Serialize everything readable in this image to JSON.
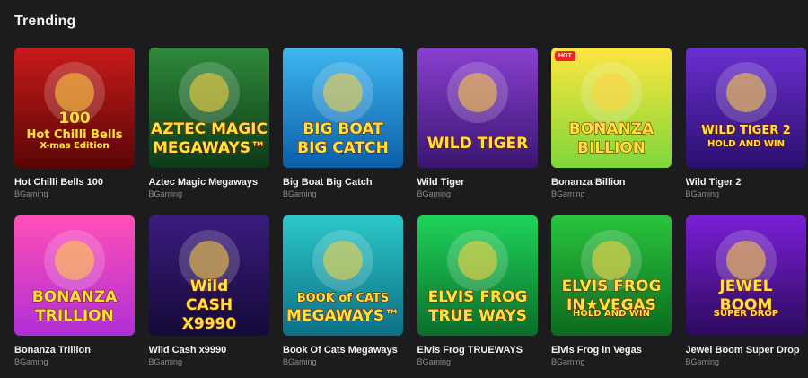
{
  "section": {
    "title": "Trending"
  },
  "games": [
    {
      "title": "Hot Chilli Bells 100",
      "provider": "BGaming",
      "art": [
        "100",
        "Hot Chilli Bells",
        "X-mas Edition"
      ],
      "badge": "",
      "bg": [
        "#c81a1a",
        "#5a0505"
      ],
      "icon": "chilli-bell-icon"
    },
    {
      "title": "Aztec Magic Megaways",
      "provider": "BGaming",
      "art": [
        "AZTEC MAGIC",
        "MEGAWAYS™"
      ],
      "badge": "",
      "bg": [
        "#2e8a3a",
        "#0d3a18"
      ],
      "icon": "aztec-queen-icon"
    },
    {
      "title": "Big Boat Big Catch",
      "provider": "BGaming",
      "art": [
        "BIG BOAT",
        "BIG CATCH"
      ],
      "badge": "",
      "bg": [
        "#3fb6ef",
        "#0b5fa8"
      ],
      "icon": "tuna-fish-icon"
    },
    {
      "title": "Wild Tiger",
      "provider": "BGaming",
      "art": [
        "WILD TIGER"
      ],
      "badge": "",
      "bg": [
        "#8a3fd1",
        "#3a1670"
      ],
      "icon": "tiger-icon"
    },
    {
      "title": "Bonanza Billion",
      "provider": "BGaming",
      "art": [
        "BONANZA",
        "BILLION"
      ],
      "badge": "HOT",
      "bg": [
        "#ffe640",
        "#7fd63a"
      ],
      "icon": "lollipop-icon"
    },
    {
      "title": "Wild Tiger 2",
      "provider": "BGaming",
      "art": [
        "WILD TIGER 2",
        "HOLD AND WIN"
      ],
      "badge": "",
      "bg": [
        "#6a2fd0",
        "#2b0f6e"
      ],
      "icon": "tiger-icon"
    },
    {
      "title": "Bonanza Trillion",
      "provider": "BGaming",
      "art": [
        "BONANZA",
        "TRILLION"
      ],
      "badge": "",
      "bg": [
        "#ff4fb8",
        "#b02fd6"
      ],
      "icon": "clover-icon"
    },
    {
      "title": "Wild Cash x9990",
      "provider": "BGaming",
      "art": [
        "Wild",
        "CASH",
        "X9990"
      ],
      "badge": "",
      "bg": [
        "#3a1c7e",
        "#150a38"
      ],
      "icon": "neon-sign-icon"
    },
    {
      "title": "Book Of Cats Megaways",
      "provider": "BGaming",
      "art": [
        "BOOK of CATS",
        "MEGAWAYS™"
      ],
      "badge": "",
      "bg": [
        "#2bc8c8",
        "#0c6f86"
      ],
      "icon": "cleopatra-icon"
    },
    {
      "title": "Elvis Frog TRUEWAYS",
      "provider": "BGaming",
      "art": [
        "ELVIS FROG",
        "TRUE WAYS"
      ],
      "badge": "",
      "bg": [
        "#1fd45a",
        "#0a6e2b"
      ],
      "icon": "frog-icon"
    },
    {
      "title": "Elvis Frog in Vegas",
      "provider": "BGaming",
      "art": [
        "ELVIS FROG",
        "IN★VEGAS",
        "HOLD AND WIN"
      ],
      "badge": "",
      "bg": [
        "#29c43d",
        "#0b6a1e"
      ],
      "icon": "frog-icon"
    },
    {
      "title": "Jewel Boom Super Drop",
      "provider": "BGaming",
      "art": [
        "JEWEL",
        "BOOM",
        "SUPER DROP"
      ],
      "badge": "",
      "bg": [
        "#7a1fd6",
        "#2b0a5e"
      ],
      "icon": "jewel-icon"
    }
  ]
}
